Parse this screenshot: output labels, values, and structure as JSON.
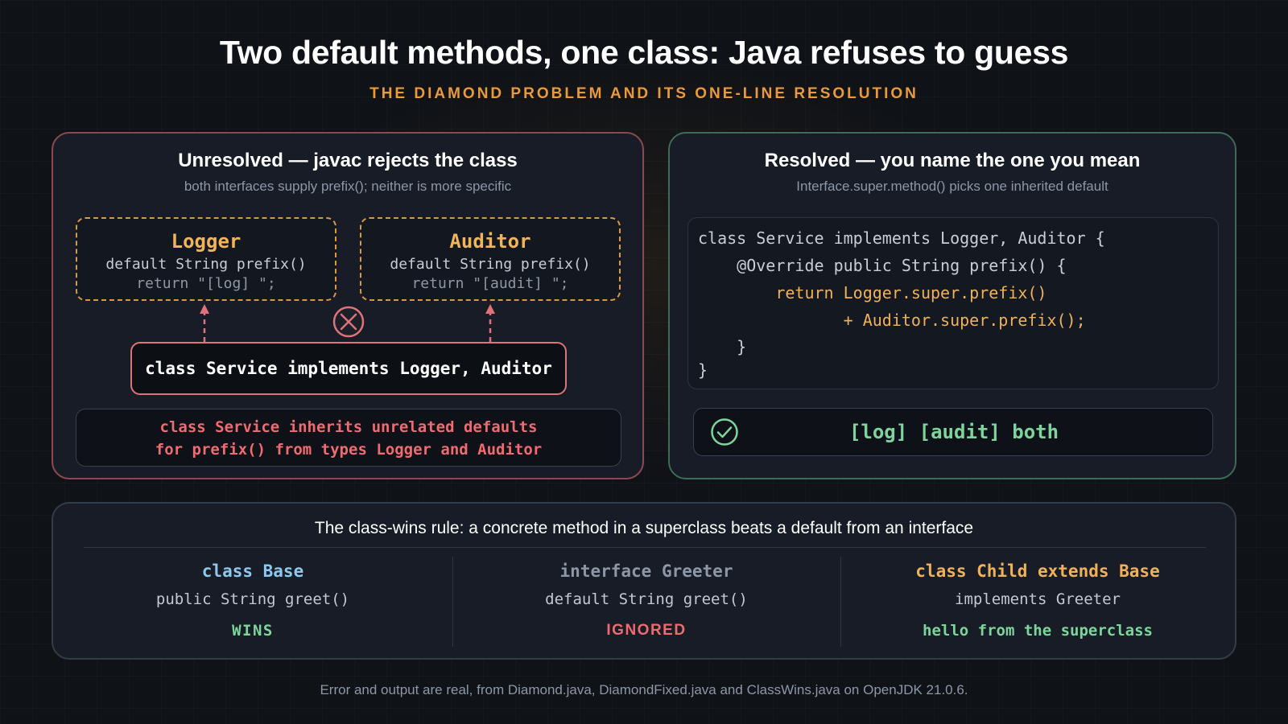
{
  "header": {
    "title": "Two default methods, one class: Java refuses to guess",
    "subtitle": "THE DIAMOND PROBLEM AND ITS ONE-LINE RESOLUTION"
  },
  "unresolved": {
    "title": "Unresolved — javac rejects the class",
    "subtitle": "both interfaces supply prefix(); neither is more specific",
    "logger": {
      "name": "Logger",
      "signature": "default String prefix()",
      "body": "return \"[log] \";"
    },
    "auditor": {
      "name": "Auditor",
      "signature": "default String prefix()",
      "body": "return \"[audit] \";"
    },
    "service": "class Service implements Logger, Auditor",
    "error_lines": [
      "class Service inherits unrelated defaults",
      "for prefix() from types Logger and Auditor"
    ]
  },
  "resolved": {
    "title": "Resolved — you name the one you mean",
    "subtitle": "Interface.super.method() picks one inherited default",
    "code_lines": [
      "class Service implements Logger, Auditor {",
      "    @Override public String prefix() {",
      "        return Logger.super.prefix()",
      "               + Auditor.super.prefix();",
      "    }",
      "}"
    ],
    "output": "[log] [audit] both"
  },
  "class_wins": {
    "rule": "The class-wins rule: a concrete method in a superclass beats a default from an interface",
    "columns": [
      {
        "head": "class Base",
        "signature": "public String greet()",
        "verdict": "WINS"
      },
      {
        "head": "interface Greeter",
        "signature": "default String greet()",
        "verdict": "IGNORED"
      },
      {
        "head": "class Child extends Base",
        "signature": "implements Greeter",
        "verdict": "hello from the superclass"
      }
    ]
  },
  "footer": "Error and output are real, from Diamond.java, DiamondFixed.java and ClassWins.java on OpenJDK 21.0.6.",
  "colors": {
    "accent_orange": "#e89a3c",
    "error_red": "#ef6b6f",
    "success_green": "#7ed59c",
    "base_blue": "#8cc8f0",
    "muted_gray": "#8e97a6"
  },
  "icons": {
    "conflict": "x-circle-icon",
    "ok": "check-circle-icon",
    "inherit": "dashed-arrow-up-icon"
  }
}
